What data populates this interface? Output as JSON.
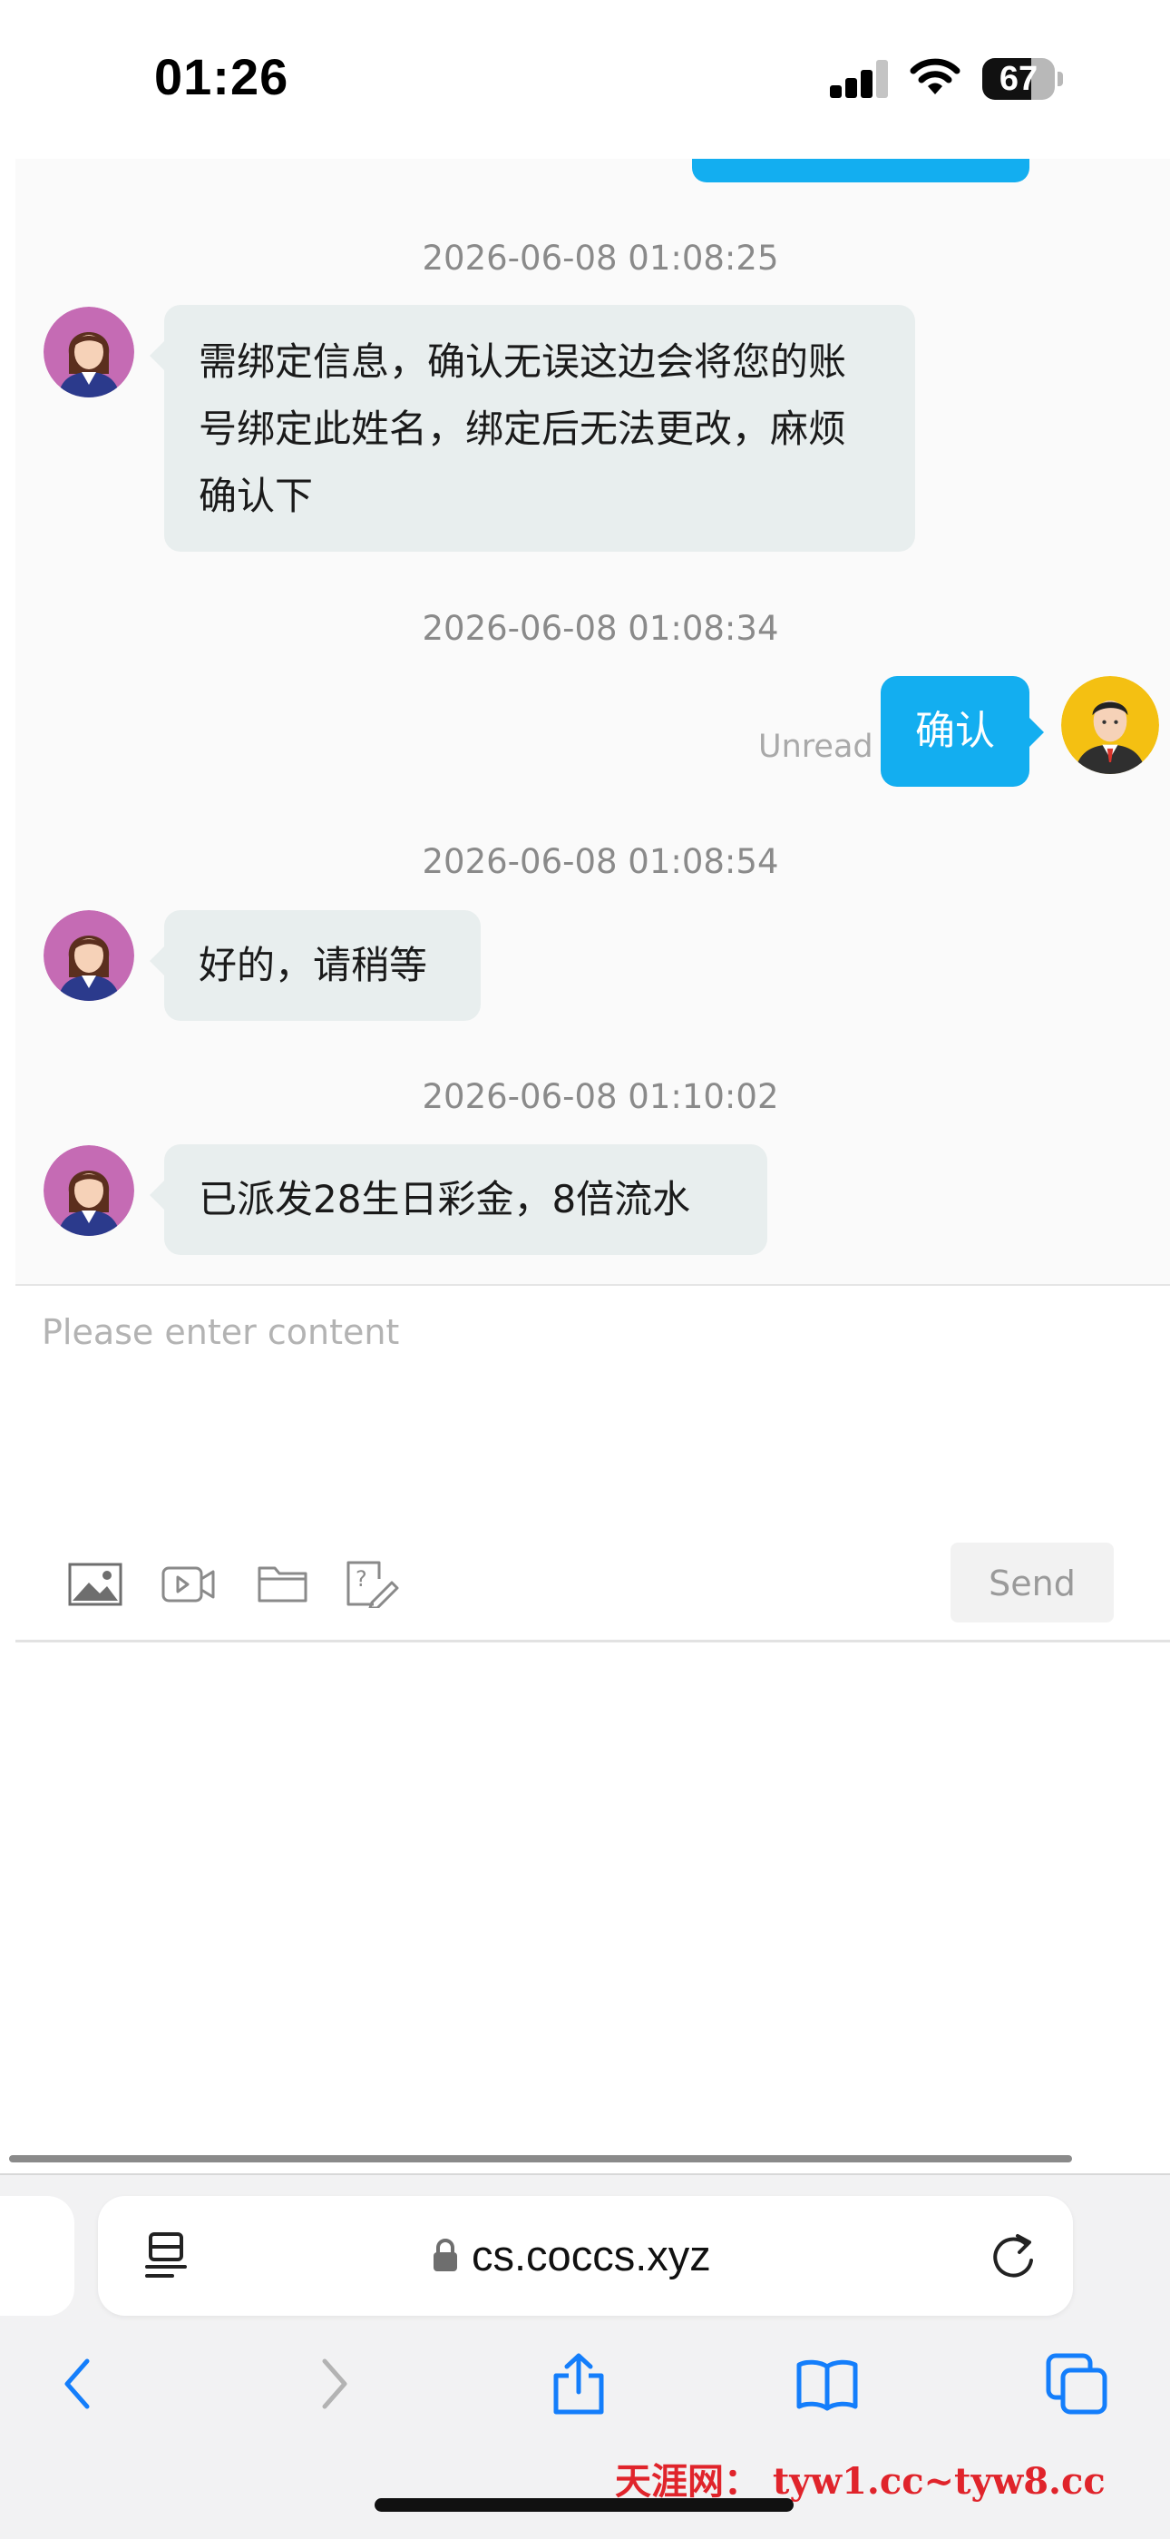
{
  "status_bar": {
    "time": "01:26",
    "battery_level": "67",
    "battery_fraction": 0.67,
    "icons": [
      "signal-icon",
      "wifi-icon",
      "battery-icon"
    ]
  },
  "chat": {
    "messages": [
      {
        "timestamp": "2026-06-08 01:08:25",
        "sender": "agent",
        "text": "需绑定信息，确认无误这边会将您的账号绑定此姓名，绑定后无法更改，麻烦确认下"
      },
      {
        "timestamp": "2026-06-08 01:08:34",
        "sender": "user",
        "text": "确认",
        "status": "Unread"
      },
      {
        "timestamp": "2026-06-08 01:08:54",
        "sender": "agent",
        "text": "好的，请稍等"
      },
      {
        "timestamp": "2026-06-08 01:10:02",
        "sender": "agent",
        "text": "已派发28生日彩金，8倍流水"
      }
    ],
    "colors": {
      "user_bubble": "#13aef0",
      "agent_bubble": "#e8eeee"
    }
  },
  "composer": {
    "placeholder": "Please enter content",
    "send_label": "Send",
    "tools": [
      "image-icon",
      "video-icon",
      "folder-icon",
      "feedback-icon"
    ]
  },
  "browser": {
    "url": "cs.coccs.xyz",
    "nav_icons": [
      "back-icon",
      "forward-icon",
      "share-icon",
      "bookmarks-icon",
      "tabs-icon"
    ]
  },
  "watermark": "天涯网： tyw1.cc~tyw8.cc"
}
